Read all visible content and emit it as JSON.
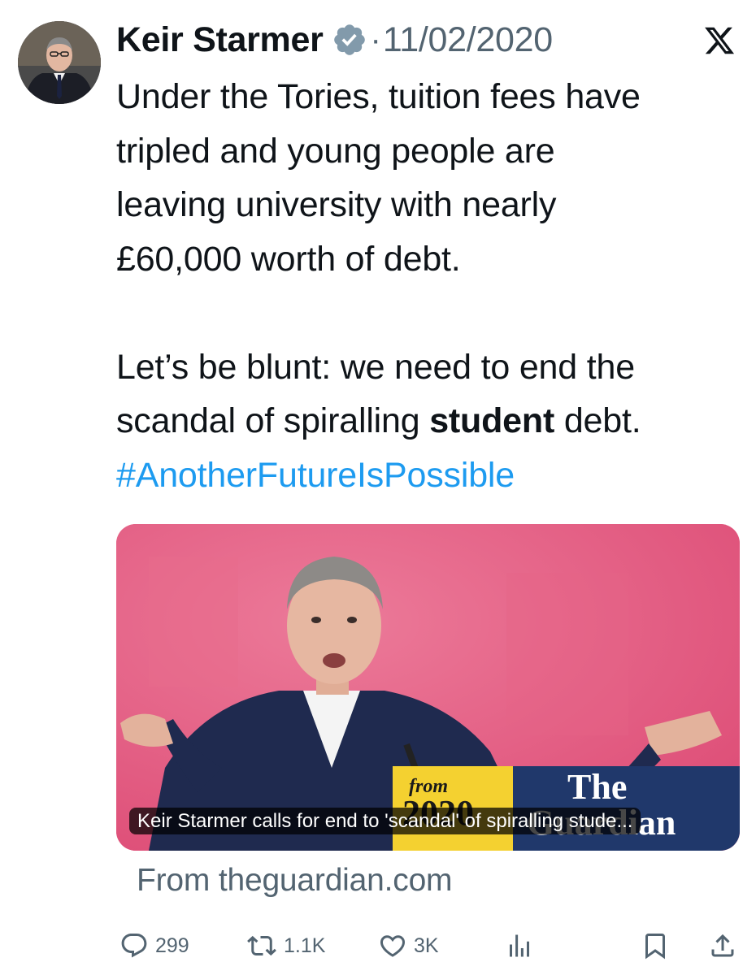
{
  "tweet": {
    "author_name": "Keir Starmer",
    "separator": "·",
    "date": "11/02/2020",
    "text_lines": [
      "Under the Tories, tuition fees have",
      "tripled and young people are",
      "leaving university with nearly",
      "£60,000 worth of debt."
    ],
    "text2_line1": "Let’s be blunt: we need to end the",
    "text2_line2_before": "scandal of spiralling ",
    "text2_line2_bold": "student",
    "text2_line2_after": " debt.",
    "hashtag": "#AnotherFutureIsPossible"
  },
  "card": {
    "caption": "Keir Starmer calls for end to 'scandal' of spiralling stude...",
    "source": "From theguardian.com",
    "image_text": {
      "from": "from",
      "year": "2020",
      "brand_line1": "The",
      "brand_line2": "Guardian"
    }
  },
  "actions": {
    "replies": "299",
    "reposts": "1.1K",
    "likes": "3K"
  },
  "icons": {
    "verified": "verified-badge-icon",
    "x_logo": "x-logo-icon",
    "reply": "reply-icon",
    "repost": "repost-icon",
    "like": "heart-icon",
    "views": "analytics-icon",
    "bookmark": "bookmark-icon",
    "share": "share-icon"
  },
  "colors": {
    "text": "#0f1419",
    "secondary": "#536471",
    "hashtag": "#1d9bf0",
    "card_background": "#e3577f"
  }
}
